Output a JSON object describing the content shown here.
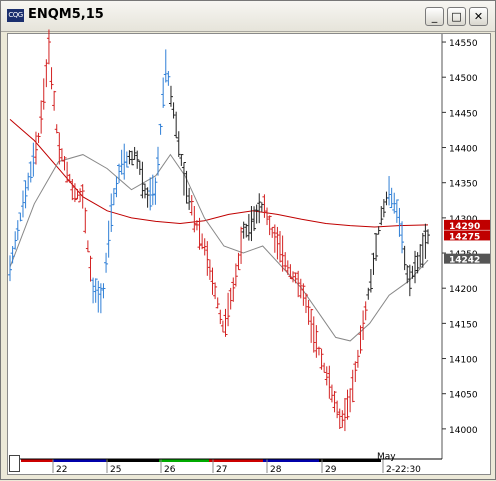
{
  "window": {
    "title": "ENQM5,15",
    "icon": "cqg-app-icon",
    "buttons": [
      {
        "name": "minimize-button",
        "glyph": "_"
      },
      {
        "name": "maximize-button",
        "glyph": "□"
      },
      {
        "name": "close-button",
        "glyph": "✕"
      }
    ]
  },
  "chart_data": {
    "type": "ohlc-bar",
    "symbol": "ENQM5",
    "interval": "15",
    "ylim": [
      13960,
      14560
    ],
    "y_tick_labels": [
      "14550",
      "14500",
      "14450",
      "14400",
      "14350",
      "14300",
      "14250",
      "14200",
      "14150",
      "14100",
      "14050",
      "14000"
    ],
    "x_tick_labels": [
      "22",
      "25",
      "26",
      "27",
      "28",
      "29",
      "2-22:30"
    ],
    "month_label": "May",
    "price_markers": [
      {
        "label": "14290",
        "color": "#ffffff",
        "bg": "#c00000"
      },
      {
        "label": "14275",
        "color": "#ffffff",
        "bg": "#c00000"
      },
      {
        "label": "14242",
        "color": "#ffffff",
        "bg": "#555555"
      }
    ],
    "colors": {
      "up_trend": "#2f7fd6",
      "down_trend": "#d32222",
      "neutral": "#222222",
      "ma_long": "#c00000",
      "ma_short": "#888888"
    },
    "day_bar_colors": [
      "#cc0000",
      "#0000aa",
      "#000000",
      "#00aa00",
      "#cc0000",
      "#0000aa",
      "#000000"
    ],
    "trend_runs": [
      {
        "color": "up_trend",
        "count": 10
      },
      {
        "color": "down_trend",
        "count": 22
      },
      {
        "color": "up_trend",
        "count": 14
      },
      {
        "color": "neutral",
        "count": 8
      },
      {
        "color": "up_trend",
        "count": 8
      },
      {
        "color": "neutral",
        "count": 8
      },
      {
        "color": "down_trend",
        "count": 20
      },
      {
        "color": "neutral",
        "count": 8
      },
      {
        "color": "down_trend",
        "count": 40
      },
      {
        "color": "neutral",
        "count": 8
      },
      {
        "color": "up_trend",
        "count": 6
      },
      {
        "color": "neutral",
        "count": 10
      }
    ],
    "price_path": [
      [
        0,
        14230
      ],
      [
        6,
        14330
      ],
      [
        12,
        14420
      ],
      [
        16,
        14540
      ],
      [
        20,
        14400
      ],
      [
        26,
        14340
      ],
      [
        30,
        14330
      ],
      [
        34,
        14200
      ],
      [
        38,
        14180
      ],
      [
        42,
        14320
      ],
      [
        46,
        14380
      ],
      [
        52,
        14390
      ],
      [
        56,
        14330
      ],
      [
        60,
        14340
      ],
      [
        64,
        14520
      ],
      [
        68,
        14440
      ],
      [
        72,
        14350
      ],
      [
        76,
        14300
      ],
      [
        80,
        14260
      ],
      [
        84,
        14200
      ],
      [
        88,
        14140
      ],
      [
        92,
        14200
      ],
      [
        96,
        14280
      ],
      [
        100,
        14300
      ],
      [
        104,
        14320
      ],
      [
        108,
        14280
      ],
      [
        112,
        14250
      ],
      [
        116,
        14220
      ],
      [
        120,
        14200
      ],
      [
        124,
        14150
      ],
      [
        128,
        14100
      ],
      [
        132,
        14060
      ],
      [
        136,
        14010
      ],
      [
        140,
        14040
      ],
      [
        144,
        14120
      ],
      [
        148,
        14200
      ],
      [
        152,
        14290
      ],
      [
        156,
        14340
      ],
      [
        160,
        14300
      ],
      [
        164,
        14210
      ],
      [
        168,
        14240
      ],
      [
        172,
        14275
      ]
    ],
    "ma_long": [
      [
        0,
        14440
      ],
      [
        10,
        14410
      ],
      [
        20,
        14370
      ],
      [
        30,
        14330
      ],
      [
        40,
        14310
      ],
      [
        50,
        14300
      ],
      [
        60,
        14295
      ],
      [
        70,
        14292
      ],
      [
        80,
        14296
      ],
      [
        90,
        14305
      ],
      [
        100,
        14310
      ],
      [
        110,
        14305
      ],
      [
        120,
        14298
      ],
      [
        130,
        14292
      ],
      [
        140,
        14289
      ],
      [
        150,
        14287
      ],
      [
        160,
        14289
      ],
      [
        172,
        14290
      ]
    ],
    "ma_short": [
      [
        0,
        14230
      ],
      [
        10,
        14320
      ],
      [
        20,
        14380
      ],
      [
        30,
        14390
      ],
      [
        40,
        14370
      ],
      [
        50,
        14340
      ],
      [
        60,
        14360
      ],
      [
        66,
        14390
      ],
      [
        72,
        14360
      ],
      [
        80,
        14300
      ],
      [
        88,
        14260
      ],
      [
        96,
        14250
      ],
      [
        104,
        14260
      ],
      [
        112,
        14230
      ],
      [
        120,
        14200
      ],
      [
        128,
        14160
      ],
      [
        134,
        14130
      ],
      [
        140,
        14125
      ],
      [
        148,
        14150
      ],
      [
        156,
        14190
      ],
      [
        164,
        14210
      ],
      [
        172,
        14240
      ]
    ]
  }
}
